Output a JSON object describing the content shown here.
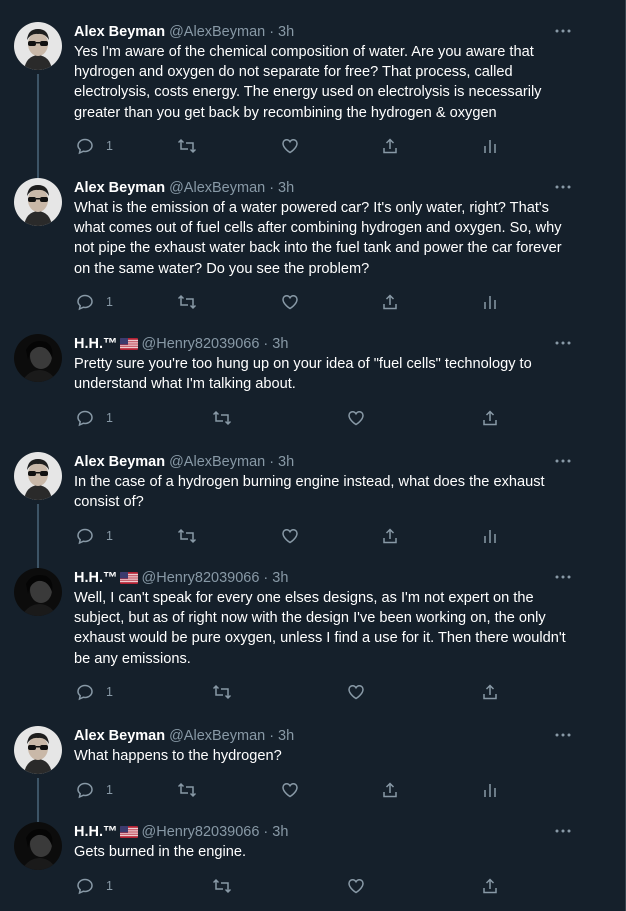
{
  "tweets": [
    {
      "name": "Alex Beyman",
      "handle": "@AlexBeyman",
      "time": "3h",
      "text": "Yes I'm aware of the chemical composition of water. Are you aware that hydrogen and oxygen do not separate for free? That process, called electrolysis, costs energy. The energy used on electrolysis is necessarily greater than you get back by recombining the hydrogen & oxygen",
      "reply_count": "1",
      "avatar": "sunglasses-man",
      "flag": false
    },
    {
      "name": "Alex Beyman",
      "handle": "@AlexBeyman",
      "time": "3h",
      "text": "What is the emission of a water powered car? It's only water, right? That's what comes out of fuel cells after combining hydrogen and oxygen. So, why not pipe the exhaust water back into the fuel tank and power the car forever on the same water? Do you see the problem?",
      "reply_count": "1",
      "avatar": "sunglasses-man",
      "flag": false
    },
    {
      "name": "H.H.™",
      "handle": "@Henry82039066",
      "time": "3h",
      "text": "Pretty sure you're too hung up on your idea of \"fuel cells\" technology to understand what I'm talking about.",
      "reply_count": "1",
      "avatar": "dark-profile",
      "flag": true
    },
    {
      "name": "Alex Beyman",
      "handle": "@AlexBeyman",
      "time": "3h",
      "text": "In the case of a hydrogen burning engine instead, what does the exhaust consist of?",
      "reply_count": "1",
      "avatar": "sunglasses-man",
      "flag": false
    },
    {
      "name": "H.H.™",
      "handle": "@Henry82039066",
      "time": "3h",
      "text": "Well, I can't speak for every one elses designs, as I'm not expert on the subject, but as of right now with the design I've been working on, the only exhaust would be pure oxygen, unless I find a use for it. Then there wouldn't be any emissions.",
      "reply_count": "1",
      "avatar": "dark-profile",
      "flag": true
    },
    {
      "name": "Alex Beyman",
      "handle": "@AlexBeyman",
      "time": "3h",
      "text": "What happens to the hydrogen?",
      "reply_count": "1",
      "avatar": "sunglasses-man",
      "flag": false
    },
    {
      "name": "H.H.™",
      "handle": "@Henry82039066",
      "time": "3h",
      "text": "Gets burned in the engine.",
      "reply_count": "1",
      "avatar": "dark-profile",
      "flag": true
    }
  ],
  "separator": "·",
  "colors": {
    "background": "#15202b",
    "text": "#ffffff",
    "secondary": "#8899a6",
    "thread_line": "#3d5466"
  },
  "icons": [
    "reply-icon",
    "retweet-icon",
    "like-icon",
    "share-icon",
    "analytics-icon",
    "more-icon",
    "us-flag-icon"
  ]
}
